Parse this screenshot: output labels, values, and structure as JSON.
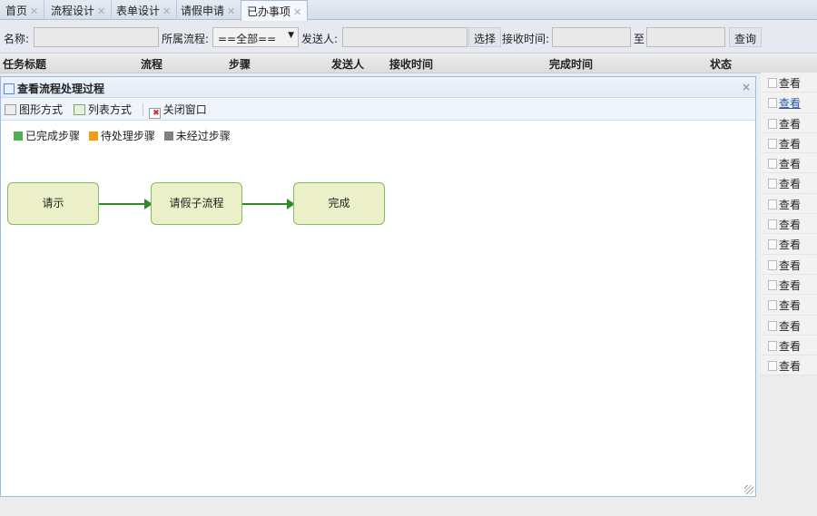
{
  "tabs": [
    {
      "label": "首页"
    },
    {
      "label": "流程设计"
    },
    {
      "label": "表单设计"
    },
    {
      "label": "请假申请"
    },
    {
      "label": "已办事项",
      "active": true
    }
  ],
  "search": {
    "name_label": "名称:",
    "name_value": "",
    "flow_label": "所属流程:",
    "flow_value": "==全部==",
    "sender_label": "发送人:",
    "sender_value": "",
    "choose_btn": "选择",
    "recv_label": "接收时间:",
    "to_label": "至",
    "query_btn": "查询"
  },
  "table": {
    "headers": [
      "任务标题",
      "流程",
      "步骤",
      "发送人",
      "接收时间",
      "完成时间",
      "状态"
    ],
    "view_label": "查看",
    "row_count": 15
  },
  "modal": {
    "title": "查看流程处理过程",
    "close": "×",
    "toolbar": {
      "graph": "图形方式",
      "list": "列表方式",
      "close_window": "关闭窗口"
    },
    "legend": [
      {
        "label": "已完成步骤",
        "color": "#4caf50"
      },
      {
        "label": "待处理步骤",
        "color": "#f39c12"
      },
      {
        "label": "未经过步骤",
        "color": "#808080"
      }
    ],
    "nodes": [
      {
        "label": "请示"
      },
      {
        "label": "请假子流程"
      },
      {
        "label": "完成"
      }
    ]
  }
}
